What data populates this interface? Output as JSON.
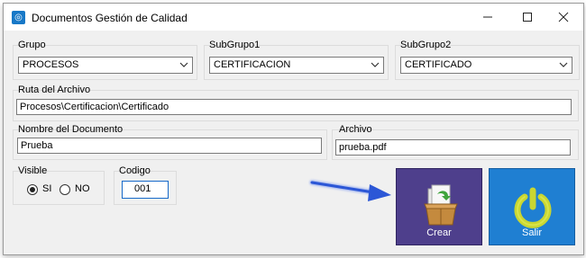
{
  "window": {
    "title": "Documentos Gestión de Calidad"
  },
  "grupo": {
    "label": "Grupo",
    "value": "PROCESOS"
  },
  "subgrupo1": {
    "label": "SubGrupo1",
    "value": "CERTIFICACION"
  },
  "subgrupo2": {
    "label": "SubGrupo2",
    "value": "CERTIFICADO"
  },
  "ruta": {
    "label": "Ruta del Archivo",
    "value": "Procesos\\Certificacion\\Certificado"
  },
  "nombre": {
    "label": "Nombre del Documento",
    "value": "Prueba"
  },
  "archivo": {
    "label": "Archivo",
    "value": "prueba.pdf"
  },
  "visible": {
    "label": "Visible",
    "options": [
      "SI",
      "NO"
    ],
    "selected": "SI"
  },
  "codigo": {
    "label": "Codigo",
    "value": "001"
  },
  "buttons": {
    "crear": {
      "label": "Crear",
      "color": "#4e3f8c",
      "icon": "cardboard-box-icon"
    },
    "salir": {
      "label": "Salir",
      "color": "#1f7fd2",
      "icon": "power-icon"
    }
  },
  "colors": {
    "arrow": "#2c57d6"
  }
}
